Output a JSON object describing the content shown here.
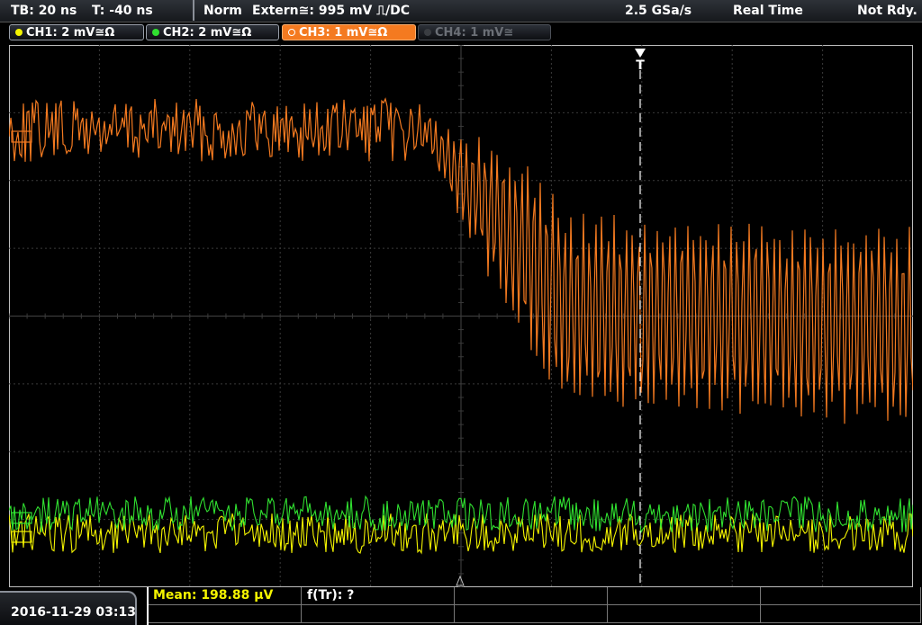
{
  "status": {
    "timebase": "TB: 20 ns",
    "trigger_time": "T: -40 ns",
    "mode": "Norm",
    "trigger_source": "Extern≅: 995 mV ⎍/DC",
    "sample_rate": "2.5 GSa/s",
    "acq_mode": "Real Time",
    "ready_state": "Not Rdy."
  },
  "channels": [
    {
      "label": "CH1: 2 mV≅Ω",
      "color": "#f4f400",
      "active": false,
      "enabled": true
    },
    {
      "label": "CH2: 2 mV≅Ω",
      "color": "#30e030",
      "active": false,
      "enabled": true
    },
    {
      "label": "CH3: 1 mV≅Ω",
      "color": "#f47a20",
      "active": true,
      "enabled": true
    },
    {
      "label": "CH4: 1 mV≅",
      "color": "#6b6f76",
      "active": false,
      "enabled": false
    }
  ],
  "trigger_marker": "T",
  "datetime": "2016-11-29 03:13",
  "measurements": {
    "mean": "Mean: 198.88 µV",
    "rise_freq": "f(Tr): ?"
  },
  "colors": {
    "ch1": "#f4f400",
    "ch2": "#30e030",
    "ch3": "#f47a20",
    "grid": "#3a3a3a",
    "background": "#000000"
  }
}
